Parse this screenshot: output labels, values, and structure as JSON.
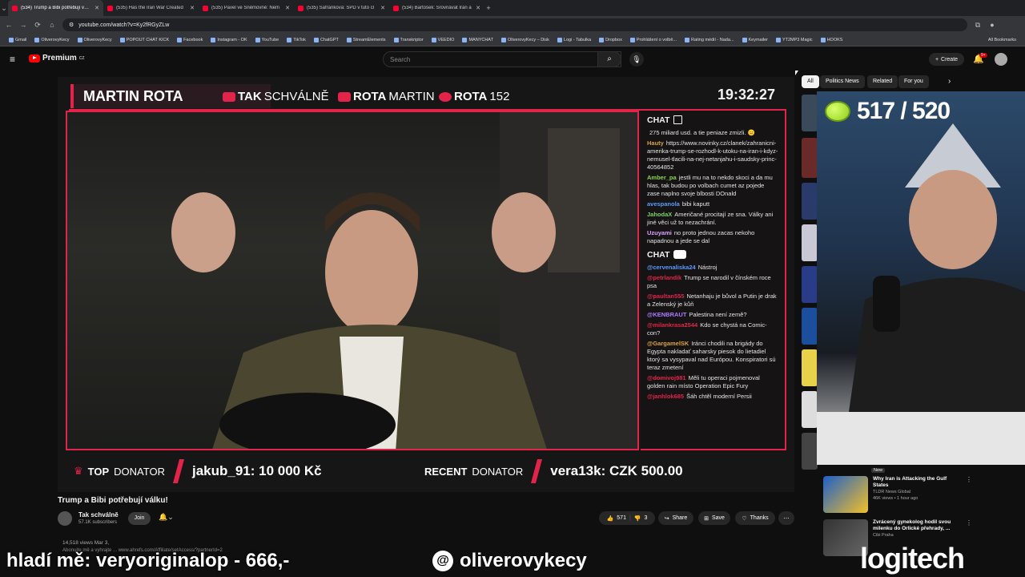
{
  "browser": {
    "tabs": [
      {
        "title": "(534) Trump a Bibi potřebují válku!",
        "active": true
      },
      {
        "title": "(535) Has the Iran War Created",
        "active": false
      },
      {
        "title": "(535) Pavel ve Sněmovně: Nem",
        "active": false
      },
      {
        "title": "(535) Šafránková: SPD v tuto cl",
        "active": false
      },
      {
        "title": "(534) Bartošek: Srovnávat Írán a",
        "active": false
      }
    ],
    "url": "youtube.com/watch?v=Ky2fRGyZLw",
    "bookmarks": [
      "Gmail",
      "OliverovyKecy",
      "OliverovyKecy",
      "POPOUT CHAT KICK",
      "Facebook",
      "Instagram - OK",
      "YouTube",
      "TikTok",
      "ChatGPT",
      "StreamElements",
      "Transkriptor",
      "VEEDIO",
      "MANYCHAT",
      "OliverovyKecy – Disk",
      "Logi - Tabulka",
      "Dropbox",
      "Prohlášení o volbě...",
      "Rating médií - Nada...",
      "Keymailer",
      "YT2MP3 Magic",
      "HOOKS"
    ],
    "all_bookmarks": "All Bookmarks"
  },
  "youtube": {
    "premium_label": "Premium",
    "premium_sup": "CZ",
    "search_placeholder": "Search",
    "create_label": "Create",
    "notif_count": "9+"
  },
  "stream": {
    "host_name": "MARTIN ROTA",
    "social": [
      {
        "bold": "TAK",
        "rest": "SCHVÁLNĚ"
      },
      {
        "bold": "ROTA",
        "rest": "MARTIN"
      },
      {
        "bold": "ROTA",
        "rest": "152"
      }
    ],
    "clock": "19:32:27",
    "chat_label": "CHAT",
    "twitch_chat": [
      {
        "user": "",
        "color": "#e6e6e6",
        "text": "275 miliard usd. a tie peniaze zmizli. 😑"
      },
      {
        "user": "Hauty",
        "color": "#d9a441",
        "text": "https://www.novinky.cz/clanek/zahranicni-amerika-trump-se-rozhodl-k-utoku-na-iran-i-kdyz-nemusel-tlacili-na-nej-netanjahu-i-saudsky-princ-40564852"
      },
      {
        "user": "Amber_pa",
        "color": "#8fd14f",
        "text": "jestli mu na to nekdo skoci a da mu hlas, tak budou po volbach cumet az pojede zase naplno svoje blbosti DOnald"
      },
      {
        "user": "avespanola",
        "color": "#5b9bff",
        "text": "bibi kaputt"
      },
      {
        "user": "JahodaX",
        "color": "#7dd36b",
        "text": "Američané procitají ze sna. Války ani jiné věci už to nezachrání."
      },
      {
        "user": "Uzuyami",
        "color": "#e0a0ff",
        "text": "no proto jednou zacas nekoho napadnou a jede se dal"
      }
    ],
    "yt_chat": [
      {
        "user": "@cervenaliska24",
        "color": "#5b9bff",
        "text": "Nástroj"
      },
      {
        "user": "@petrlandik",
        "color": "#e2234a",
        "text": "Trump se narodil v čínském roce psa"
      },
      {
        "user": "@paultan555",
        "color": "#e2234a",
        "text": "Netanhaju je bůvol a Putin je drak a Zelenský je kůň"
      },
      {
        "user": "@KENBRAUT",
        "color": "#b07bff",
        "text": "Palestina není země?"
      },
      {
        "user": "@milankrasa2544",
        "color": "#e2234a",
        "text": "Kdo se chystá na Comic-con?"
      },
      {
        "user": "@GargamelSK",
        "color": "#d9a441",
        "text": "Iránci chodili na brigády do Egypta nakladať saharsky piesok do lietadiel ktorý sa vysypaval nad Európou. Konspiratori sú teraz zmetení"
      },
      {
        "user": "@domivoj981",
        "color": "#e2234a",
        "text": "Měli tu operaci pojmenoval golden rain místo Operation Epic Fury"
      },
      {
        "user": "@janhlok685",
        "color": "#e2234a",
        "text": "Šáh chtěl moderní Persii"
      }
    ],
    "top_donator_label": {
      "bold": "TOP",
      "rest": "DONATOR"
    },
    "top_donator_value": "jakub_91: 10 000 Kč",
    "recent_donator_label": {
      "bold": "RECENT",
      "rest": "DONATOR"
    },
    "recent_donator_value": "vera13k: CZK 500.00"
  },
  "video": {
    "title": "Trump a Bibi potřebují válku!",
    "channel": "Tak schválně",
    "subscribers": "57.1K subscribers",
    "join": "Join",
    "likes": "571",
    "dislikes": "3",
    "share": "Share",
    "save": "Save",
    "thanks": "Thanks",
    "views": "14,518 views  Mar 3,",
    "description": "Abonujte mě a vyhrajte ... www.ahrefs.com/Affiliate/setAccess/?partnerId=2"
  },
  "sidebar": {
    "chips": [
      "All",
      "Politics News",
      "Related",
      "For you"
    ],
    "score": "517 / 520",
    "recommended": [
      {
        "title": "Why Iran is Attacking the Gulf States",
        "channel": "TLDR News Global",
        "meta": "46K views • 1 hour ago",
        "badge": "New"
      },
      {
        "title": "Zvrácený gynekolog hodil svou milenku do Orlické přehrady, ...",
        "channel": "Cibi Praha",
        "meta": "",
        "badge": ""
      }
    ]
  },
  "overlay": {
    "left_text": "hladí mě: veryoriginalop - 666,-",
    "threads_handle": "oliverovykecy",
    "brand": "logitech"
  }
}
